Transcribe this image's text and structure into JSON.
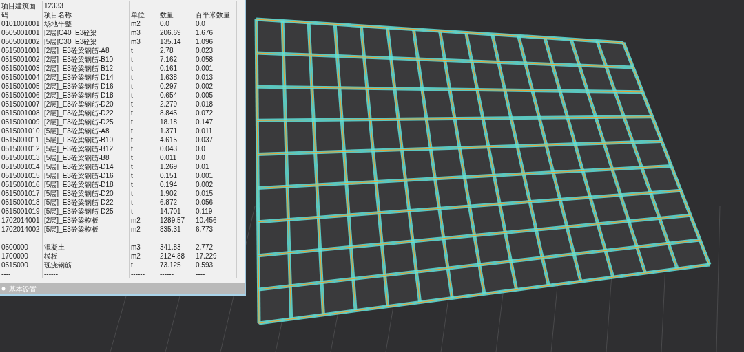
{
  "table": {
    "rows": [
      [
        "项目建筑面",
        "12333"
      ],
      [
        "码",
        "项目名称",
        "单位",
        "数量",
        "百平米数量"
      ],
      [
        "0101001001",
        "场地平整",
        "m2",
        "0.0",
        "0.0"
      ],
      [
        "0505001001",
        "[2层]C40_E3砼梁",
        "m3",
        "206.69",
        "1.676"
      ],
      [
        "0505001002",
        "[5层]C30_E3砼梁",
        "m3",
        "135.14",
        "1.096"
      ],
      [
        "0515001001",
        "[2层]_E3砼梁钢筋-A8",
        "t",
        "2.78",
        "0.023"
      ],
      [
        "0515001002",
        "[2层]_E3砼梁钢筋-B10",
        "t",
        "7.162",
        "0.058"
      ],
      [
        "0515001003",
        "[2层]_E3砼梁钢筋-B12",
        "t",
        "0.161",
        "0.001"
      ],
      [
        "0515001004",
        "[2层]_E3砼梁钢筋-D14",
        "t",
        "1.638",
        "0.013"
      ],
      [
        "0515001005",
        "[2层]_E3砼梁钢筋-D16",
        "t",
        "0.297",
        "0.002"
      ],
      [
        "0515001006",
        "[2层]_E3砼梁钢筋-D18",
        "t",
        "0.654",
        "0.005"
      ],
      [
        "0515001007",
        "[2层]_E3砼梁钢筋-D20",
        "t",
        "2.279",
        "0.018"
      ],
      [
        "0515001008",
        "[2层]_E3砼梁钢筋-D22",
        "t",
        "8.845",
        "0.072"
      ],
      [
        "0515001009",
        "[2层]_E3砼梁钢筋-D25",
        "t",
        "18.18",
        "0.147"
      ],
      [
        "0515001010",
        "[5层]_E3砼梁钢筋-A8",
        "t",
        "1.371",
        "0.011"
      ],
      [
        "0515001011",
        "[5层]_E3砼梁钢筋-B10",
        "t",
        "4.615",
        "0.037"
      ],
      [
        "0515001012",
        "[5层]_E3砼梁钢筋-B12",
        "t",
        "0.043",
        "0.0"
      ],
      [
        "0515001013",
        "[5层]_E3砼梁钢筋-B8",
        "t",
        "0.011",
        "0.0"
      ],
      [
        "0515001014",
        "[5层]_E3砼梁钢筋-D14",
        "t",
        "1.269",
        "0.01"
      ],
      [
        "0515001015",
        "[5层]_E3砼梁钢筋-D16",
        "t",
        "0.151",
        "0.001"
      ],
      [
        "0515001016",
        "[5层]_E3砼梁钢筋-D18",
        "t",
        "0.194",
        "0.002"
      ],
      [
        "0515001017",
        "[5层]_E3砼梁钢筋-D20",
        "t",
        "1.902",
        "0.015"
      ],
      [
        "0515001018",
        "[5层]_E3砼梁钢筋-D22",
        "t",
        "6.872",
        "0.056"
      ],
      [
        "0515001019",
        "[5层]_E3砼梁钢筋-D25",
        "t",
        "14.701",
        "0.119"
      ],
      [
        "1702014001",
        "[2层]_E3砼梁模板",
        "m2",
        "1289.57",
        "10.456"
      ],
      [
        "1702014002",
        "[5层]_E3砼梁模板",
        "m2",
        "835.31",
        "6.773"
      ],
      [
        "----",
        "------",
        "------",
        "------",
        "----"
      ],
      [
        "0500000",
        "混凝土",
        "m3",
        "341.83",
        "2.772"
      ],
      [
        "1700000",
        "模板",
        "m2",
        "2124.88",
        "17.229"
      ],
      [
        "0515000",
        "现浇钢筋",
        "t",
        "73.125",
        "0.593"
      ],
      [
        "----",
        "------",
        "------",
        "------",
        "----"
      ]
    ]
  },
  "footer": {
    "label": "基本设置"
  }
}
